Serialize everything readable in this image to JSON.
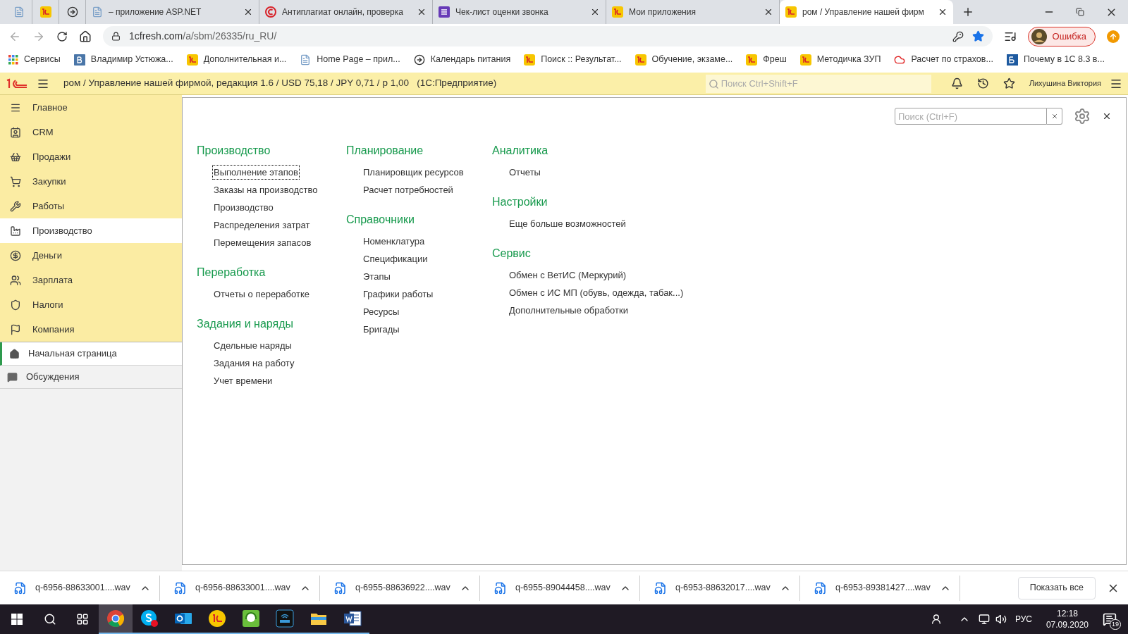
{
  "browser": {
    "tabs": [
      {
        "pinned": true,
        "selected": false
      },
      {
        "pinned": true,
        "selected": false
      },
      {
        "pinned": true,
        "selected": false
      },
      {
        "pinned": false,
        "title": "– приложение ASP.NET",
        "selected": false
      },
      {
        "pinned": false,
        "title": "Антиплагиат онлайн, проверка",
        "selected": false
      },
      {
        "pinned": false,
        "title": "Чек-лист оценки звонка",
        "selected": false
      },
      {
        "pinned": false,
        "title": "Мои приложения",
        "selected": false
      },
      {
        "pinned": false,
        "title": "ром / Управление нашей фирм",
        "selected": true
      }
    ],
    "address": {
      "host": "1cfresh.com",
      "path": "/a/sbm/26335/ru_RU/"
    },
    "profile": {
      "label": "Ошибка"
    },
    "bookmarks": [
      "Сервисы",
      "Владимир Устюжа...",
      "Дополнительная и...",
      "Home Page – прил...",
      "Календарь питания",
      "Поиск :: Результат...",
      "Обучение, экзаме...",
      "Фреш",
      "Методичка ЗУП",
      "Расчет по страхов...",
      "Почему в 1С 8.3 в..."
    ]
  },
  "app_header": {
    "title": "ром / Управление нашей фирмой, редакция 1.6 / USD 75,18 / JPY 0,71 / р 1,00   (1С:Предприятие)",
    "search": {
      "placeholder": "Поиск Ctrl+Shift+F"
    },
    "user": "Лихушина Виктория"
  },
  "sidebar": {
    "sections": [
      {
        "label": "Главное",
        "selected": false
      },
      {
        "label": "CRM",
        "selected": false
      },
      {
        "label": "Продажи",
        "selected": false
      },
      {
        "label": "Закупки",
        "selected": false
      },
      {
        "label": "Работы",
        "selected": false
      },
      {
        "label": "Производство",
        "selected": true
      },
      {
        "label": "Деньги",
        "selected": false
      },
      {
        "label": "Зарплата",
        "selected": false
      },
      {
        "label": "Налоги",
        "selected": false
      },
      {
        "label": "Компания",
        "selected": false
      }
    ],
    "pages": [
      {
        "label": "Начальная страница",
        "selected": true
      },
      {
        "label": "Обсуждения",
        "selected": false
      }
    ]
  },
  "panel": {
    "search": {
      "placeholder": "Поиск (Ctrl+F)"
    },
    "columns": [
      [
        {
          "title": "Производство",
          "items": [
            {
              "label": "Выполнение этапов",
              "focused": true
            },
            {
              "label": "Заказы на производство",
              "focused": false
            },
            {
              "label": "Производство",
              "focused": false
            },
            {
              "label": "Распределения затрат",
              "focused": false
            },
            {
              "label": "Перемещения запасов",
              "focused": false
            }
          ]
        },
        {
          "title": "Переработка",
          "items": [
            {
              "label": "Отчеты о переработке",
              "focused": false
            }
          ]
        },
        {
          "title": "Задания и наряды",
          "items": [
            {
              "label": "Сдельные наряды",
              "focused": false
            },
            {
              "label": "Задания на работу",
              "focused": false
            },
            {
              "label": "Учет времени",
              "focused": false
            }
          ]
        }
      ],
      [
        {
          "title": "Планирование",
          "items": [
            {
              "label": "Планировщик ресурсов",
              "focused": false
            },
            {
              "label": "Расчет потребностей",
              "focused": false
            }
          ]
        },
        {
          "title": "Справочники",
          "items": [
            {
              "label": "Номенклатура",
              "focused": false
            },
            {
              "label": "Спецификации",
              "focused": false
            },
            {
              "label": "Этапы",
              "focused": false
            },
            {
              "label": "Графики работы",
              "focused": false
            },
            {
              "label": "Ресурсы",
              "focused": false
            },
            {
              "label": "Бригады",
              "focused": false
            }
          ]
        }
      ],
      [
        {
          "title": "Аналитика",
          "items": [
            {
              "label": "Отчеты",
              "focused": false
            }
          ]
        },
        {
          "title": "Настройки",
          "items": [
            {
              "label": "Еще больше возможностей",
              "focused": false
            }
          ]
        },
        {
          "title": "Сервис",
          "items": [
            {
              "label": "Обмен с ВетИС (Меркурий)",
              "focused": false
            },
            {
              "label": "Обмен с ИС МП (обувь, одежда, табак...)",
              "focused": false
            },
            {
              "label": "Дополнительные обработки",
              "focused": false
            }
          ]
        }
      ]
    ]
  },
  "downloads": {
    "files": [
      "q-6956-88633001....wav",
      "q-6956-88633001....wav",
      "q-6955-88636922....wav",
      "q-6955-89044458....wav",
      "q-6953-88632017....wav",
      "q-6953-89381427....wav"
    ],
    "show_all": "Показать все"
  },
  "taskbar": {
    "apps": [
      {
        "selected": true
      },
      {
        "selected": false
      },
      {
        "selected": false
      },
      {
        "selected": false
      },
      {
        "selected": false
      },
      {
        "selected": false
      },
      {
        "selected": false
      },
      {
        "selected": false
      }
    ],
    "language": "РУС",
    "time": "12:18",
    "date": "07.09.2020",
    "notifications": "19"
  }
}
